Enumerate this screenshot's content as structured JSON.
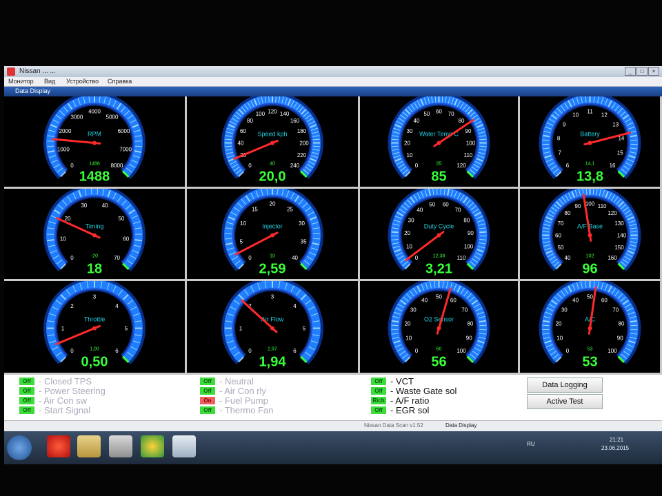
{
  "window": {
    "title": "Nissan ... ...",
    "menu": [
      "Монитор",
      "Вид",
      "Устройство",
      "Справка"
    ],
    "document_title": "Data Display",
    "controls": [
      "_",
      "□",
      "×"
    ]
  },
  "gauges": [
    {
      "id": "rpm",
      "label": "RPM",
      "value": "1488",
      "secondary": "1488",
      "ticks": [
        "0",
        "1000",
        "2000",
        "3000",
        "4000",
        "5000",
        "6000",
        "7000",
        "8000"
      ],
      "min": 0,
      "max": 8000,
      "reading": 1488
    },
    {
      "id": "speed",
      "label": "Speed kph",
      "value": "20,0",
      "secondary": "40",
      "ticks": [
        "0",
        "20",
        "40",
        "60",
        "80",
        "100",
        "120",
        "140",
        "160",
        "180",
        "200",
        "220",
        "240"
      ],
      "min": 0,
      "max": 240,
      "reading": 20
    },
    {
      "id": "water",
      "label": "Water Temp C",
      "value": "85",
      "secondary": "95",
      "ticks": [
        "0",
        "10",
        "20",
        "30",
        "40",
        "50",
        "60",
        "70",
        "80",
        "90",
        "100",
        "110",
        "120"
      ],
      "min": 0,
      "max": 120,
      "reading": 85
    },
    {
      "id": "battery",
      "label": "Battery",
      "value": "13,8",
      "secondary": "14,1",
      "ticks": [
        "6",
        "7",
        "8",
        "9",
        "10",
        "11",
        "12",
        "13",
        "14",
        "15",
        "16"
      ],
      "min": 6,
      "max": 16,
      "reading": 13.8
    },
    {
      "id": "timing",
      "label": "Timing",
      "value": "18",
      "secondary": "-20",
      "ticks": [
        "0",
        "10",
        "20",
        "30",
        "40",
        "50",
        "60",
        "70"
      ],
      "min": 0,
      "max": 70,
      "reading": 18
    },
    {
      "id": "injector",
      "label": "Injector",
      "value": "2,59",
      "secondary": "10",
      "ticks": [
        "0",
        "5",
        "10",
        "15",
        "20",
        "25",
        "30",
        "35",
        "40"
      ],
      "min": 0,
      "max": 40,
      "reading": 2.59
    },
    {
      "id": "duty",
      "label": "Duty Cycle",
      "value": "3,21",
      "secondary": "12,38",
      "ticks": [
        "0",
        "10",
        "20",
        "30",
        "40",
        "50",
        "60",
        "70",
        "80",
        "90",
        "100",
        "110"
      ],
      "min": 0,
      "max": 110,
      "reading": 3.21
    },
    {
      "id": "afbase",
      "label": "A/F Base",
      "value": "96",
      "secondary": "102",
      "ticks": [
        "40",
        "50",
        "60",
        "70",
        "80",
        "90",
        "100",
        "110",
        "120",
        "130",
        "140",
        "150",
        "160"
      ],
      "min": 40,
      "max": 160,
      "reading": 96
    },
    {
      "id": "throttle",
      "label": "Throttle",
      "value": "0,50",
      "secondary": "1,00",
      "ticks": [
        "0",
        "1",
        "2",
        "3",
        "4",
        "5",
        "6"
      ],
      "min": 0,
      "max": 6,
      "reading": 0.5
    },
    {
      "id": "airflow",
      "label": "Air Flow",
      "value": "1,94",
      "secondary": "2,97",
      "ticks": [
        "0",
        "1",
        "2",
        "3",
        "4",
        "5",
        "6"
      ],
      "min": 0,
      "max": 6,
      "reading": 1.94
    },
    {
      "id": "o2",
      "label": "O2 Sensor",
      "value": "56",
      "secondary": "60",
      "ticks": [
        "0",
        "10",
        "20",
        "30",
        "40",
        "50",
        "60",
        "70",
        "80",
        "90",
        "100"
      ],
      "min": 0,
      "max": 100,
      "reading": 56
    },
    {
      "id": "afc",
      "label": "A/C",
      "value": "53",
      "secondary": "53",
      "ticks": [
        "0",
        "10",
        "20",
        "30",
        "40",
        "50",
        "60",
        "70",
        "80",
        "90",
        "100"
      ],
      "min": 0,
      "max": 100,
      "reading": 53
    }
  ],
  "status": {
    "col1": [
      {
        "flag": "Off",
        "label": "- Closed TPS",
        "state": "on"
      },
      {
        "flag": "Off",
        "label": "- Power Steering",
        "state": "on"
      },
      {
        "flag": "Off",
        "label": "- Air Con sw",
        "state": "on"
      },
      {
        "flag": "Off",
        "label": "- Start Signal",
        "state": "on"
      }
    ],
    "col2": [
      {
        "flag": "Off",
        "label": "- Neutral",
        "state": "on"
      },
      {
        "flag": "Off",
        "label": "- Air Con rly",
        "state": "on"
      },
      {
        "flag": "On",
        "label": "- Fuel Pump",
        "state": "off"
      },
      {
        "flag": "Off",
        "label": "- Thermo Fan",
        "state": "on"
      }
    ],
    "col3": [
      {
        "flag": "Off",
        "label": "- VCT",
        "state": "on"
      },
      {
        "flag": "Off",
        "label": "- Waste Gate sol",
        "state": "on"
      },
      {
        "flag": "Rich",
        "label": "- A/F ratio",
        "state": "rich"
      },
      {
        "flag": "Off",
        "label": "- EGR sol",
        "state": "on"
      }
    ],
    "buttons": {
      "logging": "Data Logging",
      "active_test": "Active Test"
    }
  },
  "tabs": [
    "Nissan Data Scan v1.52",
    "Data Display"
  ],
  "tray": {
    "lang": "RU",
    "time": "21:21",
    "date": "23.06.2015"
  },
  "colors": {
    "arc": "#1f7fff",
    "value": "#39ff39",
    "label": "#22d0e0",
    "needle": "#ff2a2a",
    "tick": "#ffffff"
  }
}
